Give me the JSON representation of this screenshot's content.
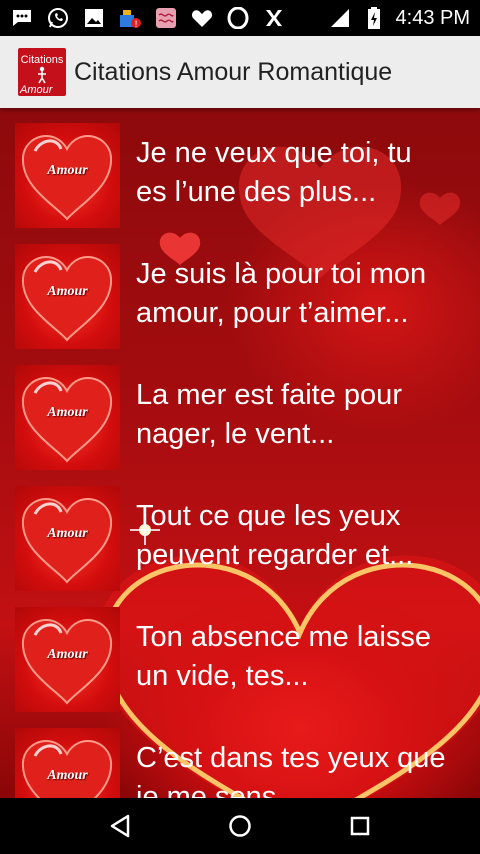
{
  "status_bar": {
    "time": "4:43 PM",
    "icons_left": [
      "message-icon",
      "whatsapp-icon",
      "image-icon",
      "cleaner-alert-icon",
      "app-thumbnail-icon",
      "heart-outline-icon",
      "opera-icon",
      "x-icon"
    ],
    "icons_right": [
      "signal-icon",
      "battery-icon"
    ]
  },
  "app_bar": {
    "title": "Citations Amour Romantique",
    "icon_top_text": "Citations",
    "icon_bottom_text": "Amour"
  },
  "list": {
    "thumb_label": "Amour",
    "items": [
      {
        "text_line1": "Je ne veux que toi, tu",
        "text_line2": "es l’une des plus..."
      },
      {
        "text_line1": "Je suis là pour toi mon",
        "text_line2": "amour, pour t’aimer..."
      },
      {
        "text_line1": "La mer est faite pour",
        "text_line2": "nager, le vent..."
      },
      {
        "text_line1": "Tout ce que les yeux",
        "text_line2": "peuvent regarder et..."
      },
      {
        "text_line1": "Ton absence me laisse",
        "text_line2": "un vide, tes..."
      },
      {
        "text_line1": "C’est dans tes yeux que",
        "text_line2": "je me sens..."
      }
    ]
  },
  "nav_bar": {
    "buttons": [
      "back-icon",
      "home-icon",
      "recents-icon"
    ]
  },
  "colors": {
    "app_bar_bg": "#ededed",
    "content_red": "#c21013",
    "status_bg": "#000000"
  }
}
